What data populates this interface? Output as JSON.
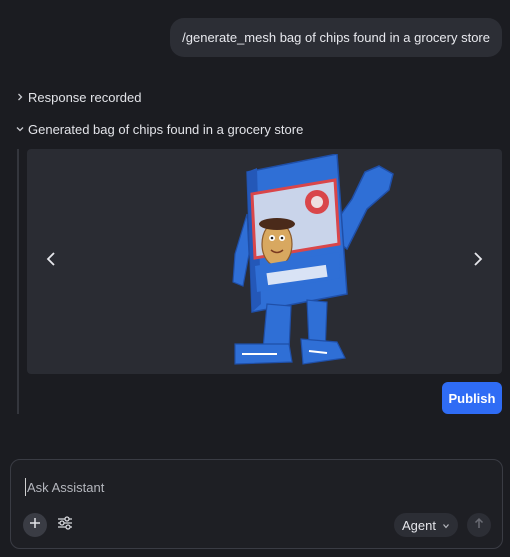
{
  "conversation": {
    "user_message": "/generate_mesh bag of chips found in a grocery store",
    "response_section": {
      "label": "Response recorded",
      "state": "collapsed"
    },
    "generated_section": {
      "label": "Generated bag of chips found in a grocery store",
      "state": "expanded"
    }
  },
  "viewer": {
    "prev_icon": "chevron-left-icon",
    "next_icon": "chevron-right-icon",
    "mesh_colors": {
      "bag": "#2f6fd6",
      "bag_dark": "#1f4fa8",
      "label_red": "#d9464a",
      "mascot": "#d8a860"
    }
  },
  "actions": {
    "publish_label": "Publish"
  },
  "composer": {
    "placeholder": "Ask Assistant",
    "value": "",
    "mode": "Agent"
  },
  "colors": {
    "accent": "#2f6cf5",
    "background": "#1b1c21",
    "panel": "#2a2c33"
  }
}
